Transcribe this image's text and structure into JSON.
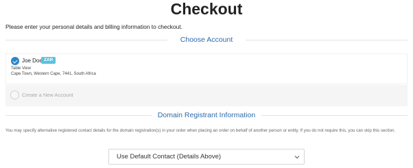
{
  "page": {
    "title": "Checkout",
    "intro": "Please enter your personal details and billing information to checkout."
  },
  "account_section": {
    "heading": "Choose Account",
    "selected_account": {
      "name": "Joe Doe",
      "currency_badge": "ZAR",
      "company": "Table View",
      "address": "Cape Town, Western Cape, 7441, South Africa"
    },
    "new_account_label": "Create a New Account"
  },
  "domain_section": {
    "heading": "Domain Registrant Information",
    "description": "You may specify alternative registered contact details for the domain registration(s) in your order when placing an order on behalf of another person or entity. If you do not require this, you can skip this section.",
    "contact_select": {
      "selected": "Use Default Contact (Details Above)"
    }
  },
  "colors": {
    "accent": "#2d86c8",
    "heading": "#2d6aa8",
    "badge": "#5bc0de"
  },
  "icons": {
    "selected_radio": "check-circle-icon",
    "empty_radio": "radio-empty-icon",
    "select_chevron": "chevron-down-icon"
  }
}
